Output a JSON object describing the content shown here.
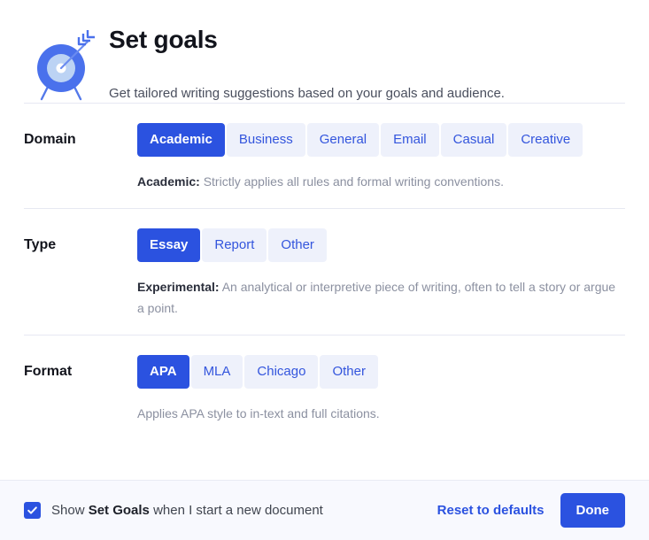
{
  "header": {
    "icon": "target-arrow-icon",
    "title": "Set goals",
    "subtitle": "Get tailored writing suggestions based on your goals and audience."
  },
  "colors": {
    "accent": "#2b52e0",
    "chip_background": "#eef1fb",
    "chip_text": "#3355dd",
    "divider": "#e6e8f2",
    "footer_background": "#f8f9fe",
    "muted_text": "#8b90a0"
  },
  "settings": [
    {
      "key": "domain",
      "label": "Domain",
      "options": [
        "Academic",
        "Business",
        "General",
        "Email",
        "Casual",
        "Creative"
      ],
      "selected": "Academic",
      "description_strong": "Academic:",
      "description_rest": " Strictly applies all rules and formal writing conventions."
    },
    {
      "key": "type",
      "label": "Type",
      "options": [
        "Essay",
        "Report",
        "Other"
      ],
      "selected": "Essay",
      "description_strong": "Experimental:",
      "description_rest": " An analytical or interpretive piece of writing, often to tell a story or argue a point."
    },
    {
      "key": "format",
      "label": "Format",
      "options": [
        "APA",
        "MLA",
        "Chicago",
        "Other"
      ],
      "selected": "APA",
      "description_strong": "",
      "description_rest": "Applies APA style to in-text and full citations."
    }
  ],
  "footer": {
    "checkbox_checked": true,
    "checkbox_icon": "checkmark-icon",
    "checkbox_label_part1": "Show ",
    "checkbox_label_strong": "Set Goals",
    "checkbox_label_part2": " when I start a new document",
    "reset_label": "Reset to defaults",
    "done_label": "Done"
  }
}
